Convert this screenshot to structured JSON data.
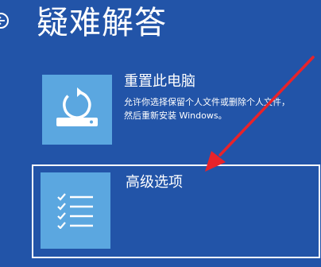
{
  "header": {
    "title": "疑难解答",
    "back_icon": "back-arrow-icon"
  },
  "options": [
    {
      "title": "重置此电脑",
      "description": "允许你选择保留个人文件或删除个人文件，然后重新安装 Windows。",
      "icon": "reset-pc-icon"
    },
    {
      "title": "高级选项",
      "icon": "checklist-icon"
    }
  ],
  "colors": {
    "background": "#2254a8",
    "tile": "#5ba7e0",
    "arrow": "#e8232a",
    "text": "#ffffff"
  }
}
